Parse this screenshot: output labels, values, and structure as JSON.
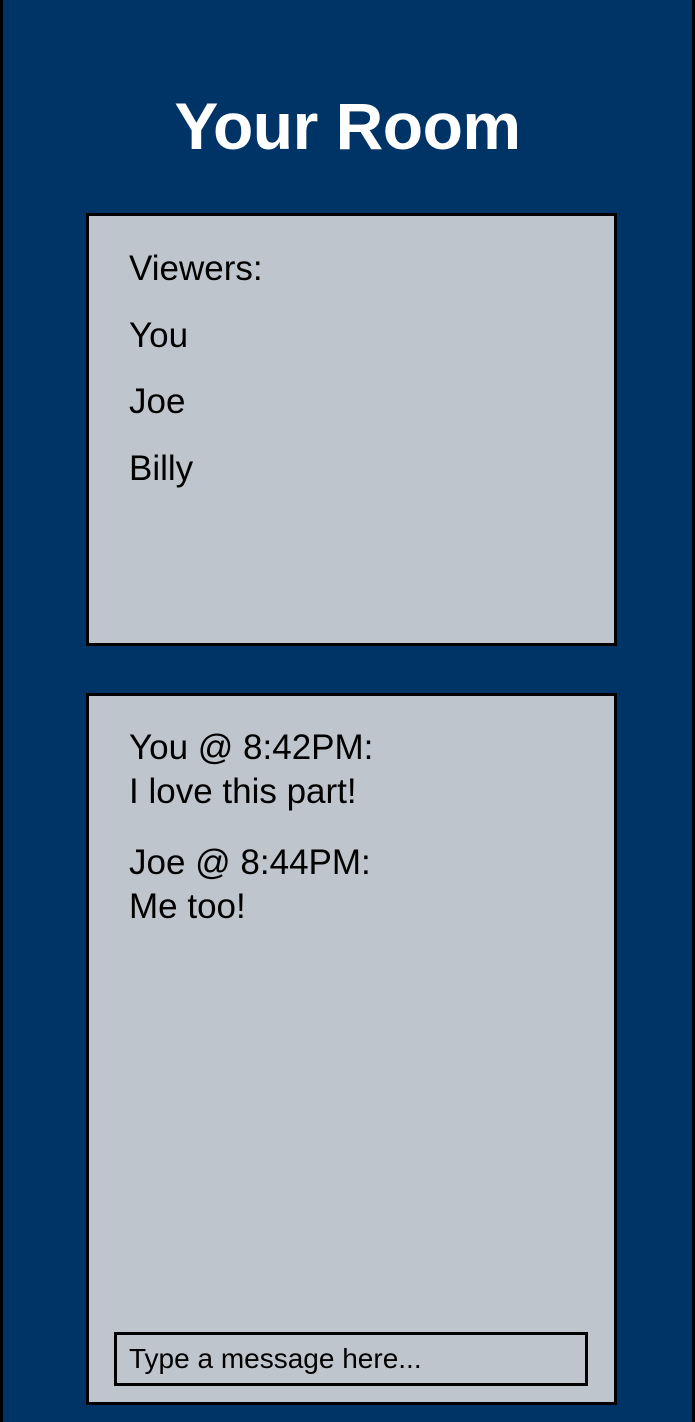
{
  "page": {
    "title": "Your Room"
  },
  "viewers": {
    "heading": "Viewers:",
    "items": [
      {
        "name": "You"
      },
      {
        "name": "Joe"
      },
      {
        "name": "Billy"
      }
    ]
  },
  "chat": {
    "messages": [
      {
        "meta": "You @ 8:42PM:",
        "text": "I love this part!"
      },
      {
        "meta": "Joe @ 8:44PM:",
        "text": "Me too!"
      }
    ],
    "input": {
      "value": "",
      "placeholder": "Type a message here..."
    }
  },
  "colors": {
    "background": "#003366",
    "panel": "#bfc5cc",
    "border": "#000000",
    "title": "#ffffff"
  }
}
